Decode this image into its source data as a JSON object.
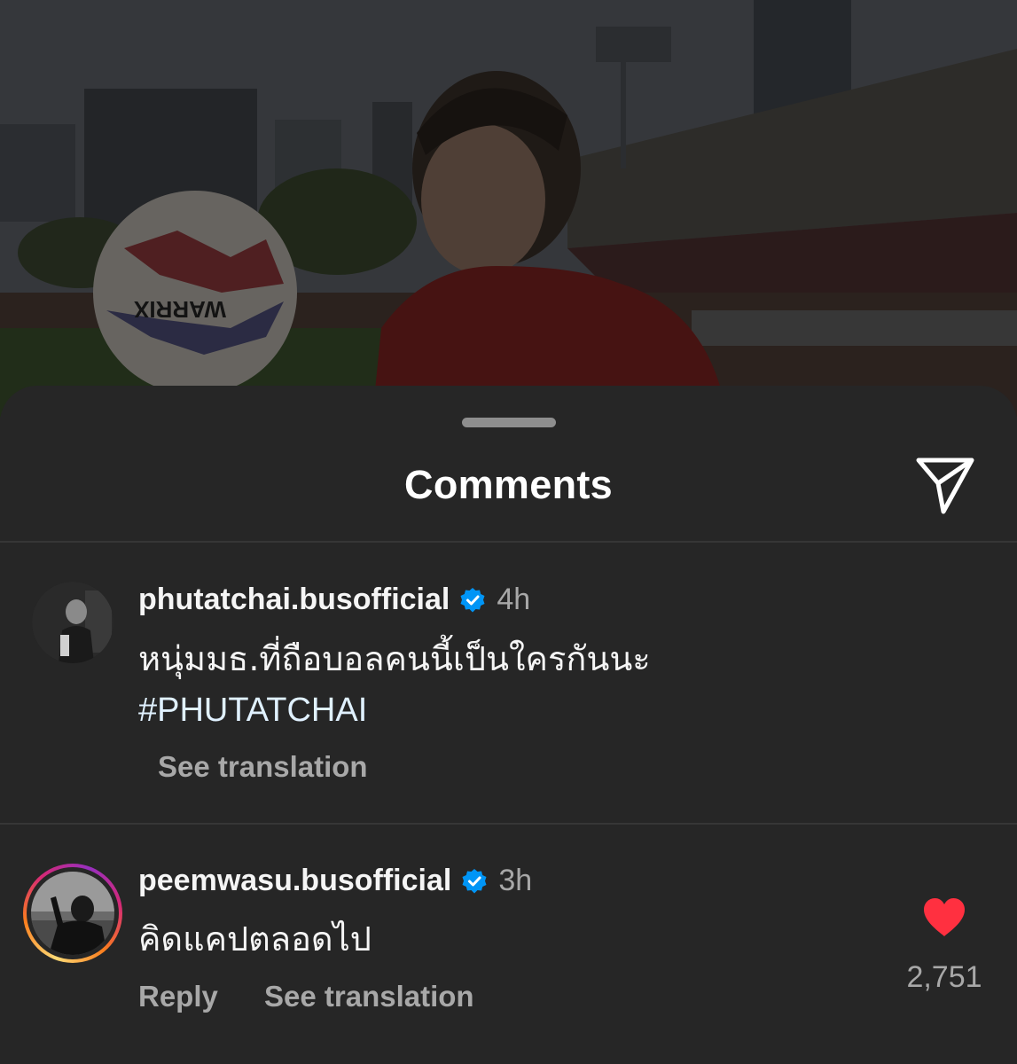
{
  "post_photo": {
    "alt_subject": "photo",
    "ball_brand": "WARRIX"
  },
  "sheet": {
    "title": "Comments",
    "share_icon": "paper-plane-icon"
  },
  "comments": [
    {
      "username": "phutatchai.busofficial",
      "verified": true,
      "time": "4h",
      "text": "หนุ่มมธ.ที่ถือบอลคนนี้เป็นใครกันนะ",
      "hashtag": "#PHUTATCHAI",
      "see_translation": "See translation"
    },
    {
      "username": "peemwasu.busofficial",
      "verified": true,
      "time": "3h",
      "text": "คิดแคปตลอดไป",
      "reply": "Reply",
      "see_translation": "See translation",
      "liked": true,
      "like_count": "2,751"
    }
  ],
  "colors": {
    "background": "#262626",
    "verified_badge": "#0095f6",
    "heart": "#ff3040",
    "muted_text": "#a8a8a8"
  }
}
